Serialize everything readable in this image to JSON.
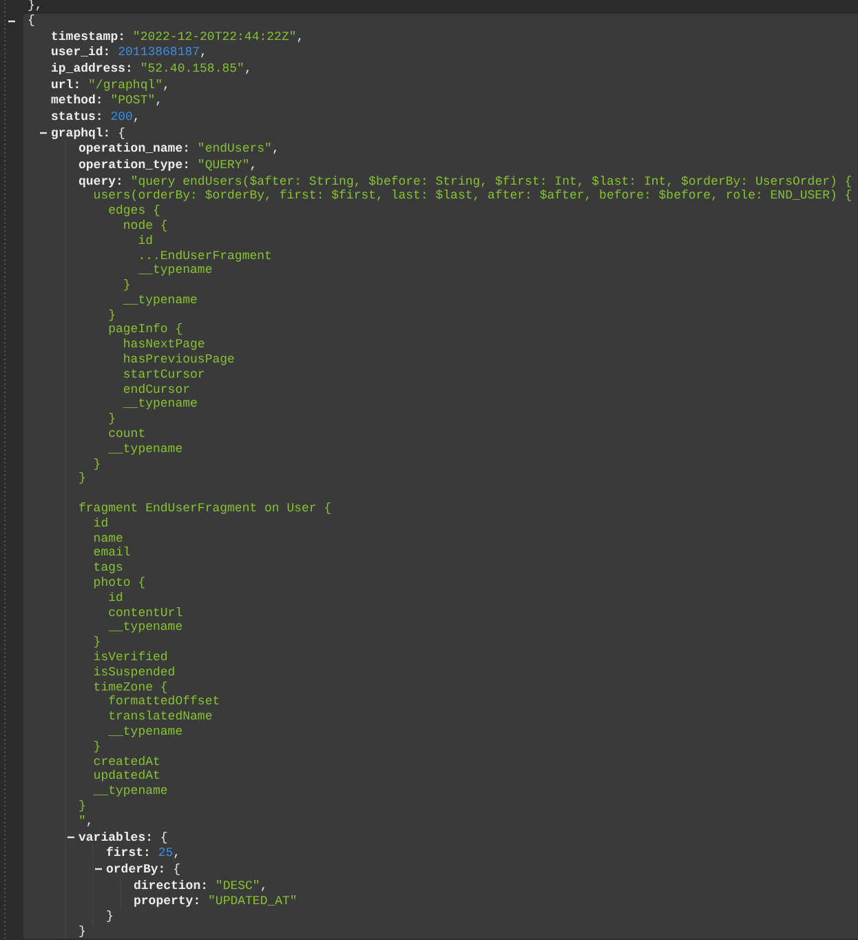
{
  "previous_close": "},",
  "root": {
    "expanded": true,
    "open": "{",
    "entries": [
      {
        "kind": "string",
        "key": "timestamp:",
        "value": "\"2022-12-20T22:44:22Z\"",
        "trail": ","
      },
      {
        "kind": "number",
        "key": "user_id:",
        "value": "20113868187",
        "trail": ","
      },
      {
        "kind": "string",
        "key": "ip_address:",
        "value": "\"52.40.158.85\"",
        "trail": ","
      },
      {
        "kind": "string",
        "key": "url:",
        "value": "\"/graphql\"",
        "trail": ","
      },
      {
        "kind": "string",
        "key": "method:",
        "value": "\"POST\"",
        "trail": ","
      },
      {
        "kind": "number",
        "key": "status:",
        "value": "200",
        "trail": ","
      },
      {
        "kind": "object",
        "key": "graphql:",
        "expanded": true,
        "open": "{",
        "entries": [
          {
            "kind": "string",
            "key": "operation_name:",
            "value": "\"endUsers\"",
            "trail": ","
          },
          {
            "kind": "string",
            "key": "operation_type:",
            "value": "\"QUERY\"",
            "trail": ","
          },
          {
            "kind": "string",
            "key": "query:",
            "value": "\"query endUsers($after: String, $before: String, $first: Int, $last: Int, $orderBy: UsersOrder) {\n  users(orderBy: $orderBy, first: $first, last: $last, after: $after, before: $before, role: END_USER) {\n    edges {\n      node {\n        id\n        ...EndUserFragment\n        __typename\n      }\n      __typename\n    }\n    pageInfo {\n      hasNextPage\n      hasPreviousPage\n      startCursor\n      endCursor\n      __typename\n    }\n    count\n    __typename\n  }\n}\n\nfragment EndUserFragment on User {\n  id\n  name\n  email\n  tags\n  photo {\n    id\n    contentUrl\n    __typename\n  }\n  isVerified\n  isSuspended\n  timeZone {\n    formattedOffset\n    translatedName\n    __typename\n  }\n  createdAt\n  updatedAt\n  __typename\n}\n\"",
            "trail": ","
          },
          {
            "kind": "object",
            "key": "variables:",
            "expanded": true,
            "open": "{",
            "entries": [
              {
                "kind": "number",
                "key": "first:",
                "value": "25",
                "trail": ","
              },
              {
                "kind": "object",
                "key": "orderBy:",
                "expanded": true,
                "open": "{",
                "entries": [
                  {
                    "kind": "string",
                    "key": "direction:",
                    "value": "\"DESC\"",
                    "trail": ","
                  },
                  {
                    "kind": "string",
                    "key": "property:",
                    "value": "\"UPDATED_AT\""
                  }
                ],
                "close": "}"
              }
            ],
            "close": "}"
          }
        ]
      }
    ]
  }
}
